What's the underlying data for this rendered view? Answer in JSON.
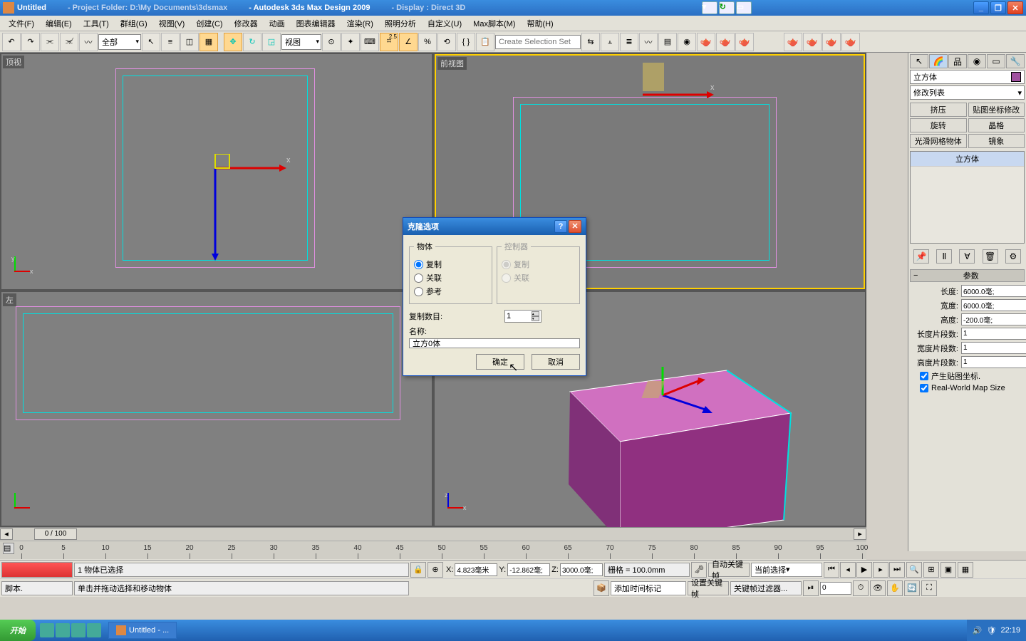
{
  "title": {
    "doc": "Untitled",
    "project": "- Project Folder: D:\\My Documents\\3dsmax",
    "app": "- Autodesk 3ds Max Design 2009",
    "display": "- Display : Direct 3D"
  },
  "menu": [
    "文件(F)",
    "编辑(E)",
    "工具(T)",
    "群组(G)",
    "视图(V)",
    "创建(C)",
    "修改器",
    "动画",
    "图表编辑器",
    "渲染(R)",
    "照明分析",
    "自定义(U)",
    "Max脚本(M)",
    "帮助(H)"
  ],
  "toolbar": {
    "sel_filter": "全部",
    "coord_sys": "视图",
    "snap_label": "2.5",
    "named_sel_placeholder": "Create Selection Set"
  },
  "viewports": {
    "tl": "顶视",
    "tr": "前视图",
    "bl": "左",
    "br": ""
  },
  "rightpanel": {
    "obj_name": "立方体",
    "mod_list": "修改列表",
    "btns": [
      "挤压",
      "贴图坐标修改",
      "旋转",
      "晶格",
      "光滑网格物体",
      "镜象"
    ],
    "stack_sel": "立方体",
    "rollup": "参数",
    "params": {
      "length_lbl": "长度:",
      "length": "6000.0毫;",
      "width_lbl": "宽度:",
      "width": "6000.0毫;",
      "height_lbl": "高度:",
      "height": "-200.0毫;",
      "lseg_lbl": "长度片段数:",
      "lseg": "1",
      "wseg_lbl": "宽度片段数:",
      "wseg": "1",
      "hseg_lbl": "高度片段数:",
      "hseg": "1",
      "gen_map": "产生贴图坐标.",
      "real_world": "Real-World Map Size"
    }
  },
  "timeline": {
    "pos": "0 / 100",
    "ticks": [
      0,
      5,
      10,
      15,
      20,
      25,
      30,
      35,
      40,
      45,
      50,
      55,
      60,
      65,
      70,
      75,
      80,
      85,
      90,
      95,
      100
    ]
  },
  "status": {
    "sel": "1 物体已选择",
    "hint": "单击并拖动选择和移动物体",
    "script": "脚本.",
    "x": "4.823毫米",
    "y": "-12.862毫;",
    "z": "3000.0毫;",
    "grid": "栅格 = 100.0mm",
    "add_time": "添加时间标记",
    "autokey": "自动关键帧",
    "setkey": "设置关键帧",
    "time_cfg": "当前选择",
    "keyfilter": "关键帧过滤器...",
    "frame": "0"
  },
  "dialog": {
    "title": "克隆选项",
    "obj_group": "物体",
    "ctrl_group": "控制器",
    "opt_copy": "复制",
    "opt_inst": "关联",
    "opt_ref": "参考",
    "copies_lbl": "复制数目:",
    "copies": "1",
    "name_lbl": "名称:",
    "name": "立方0体",
    "ok": "确定",
    "cancel": "取消"
  },
  "taskbar": {
    "start": "开始",
    "task": "Untitled    - ...",
    "time": "22:19"
  }
}
